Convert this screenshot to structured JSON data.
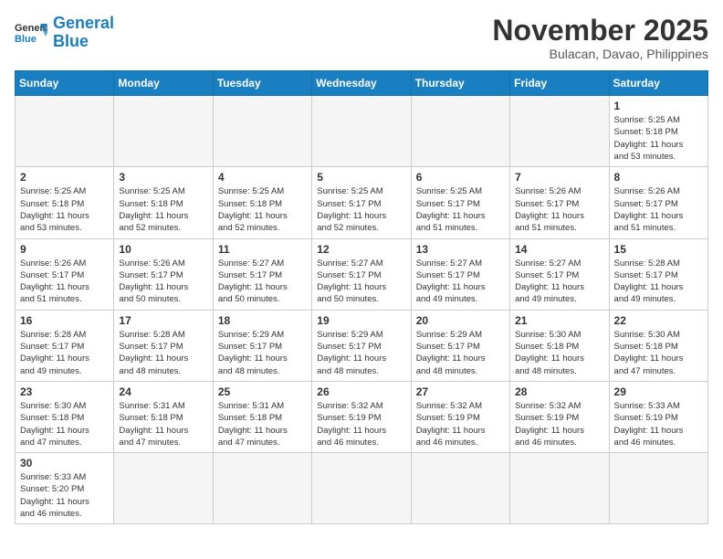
{
  "header": {
    "logo_general": "General",
    "logo_blue": "Blue",
    "month_title": "November 2025",
    "subtitle": "Bulacan, Davao, Philippines"
  },
  "weekdays": [
    "Sunday",
    "Monday",
    "Tuesday",
    "Wednesday",
    "Thursday",
    "Friday",
    "Saturday"
  ],
  "weeks": [
    [
      {
        "day": "",
        "info": ""
      },
      {
        "day": "",
        "info": ""
      },
      {
        "day": "",
        "info": ""
      },
      {
        "day": "",
        "info": ""
      },
      {
        "day": "",
        "info": ""
      },
      {
        "day": "",
        "info": ""
      },
      {
        "day": "1",
        "info": "Sunrise: 5:25 AM\nSunset: 5:18 PM\nDaylight: 11 hours\nand 53 minutes."
      }
    ],
    [
      {
        "day": "2",
        "info": "Sunrise: 5:25 AM\nSunset: 5:18 PM\nDaylight: 11 hours\nand 53 minutes."
      },
      {
        "day": "3",
        "info": "Sunrise: 5:25 AM\nSunset: 5:18 PM\nDaylight: 11 hours\nand 52 minutes."
      },
      {
        "day": "4",
        "info": "Sunrise: 5:25 AM\nSunset: 5:18 PM\nDaylight: 11 hours\nand 52 minutes."
      },
      {
        "day": "5",
        "info": "Sunrise: 5:25 AM\nSunset: 5:17 PM\nDaylight: 11 hours\nand 52 minutes."
      },
      {
        "day": "6",
        "info": "Sunrise: 5:25 AM\nSunset: 5:17 PM\nDaylight: 11 hours\nand 51 minutes."
      },
      {
        "day": "7",
        "info": "Sunrise: 5:26 AM\nSunset: 5:17 PM\nDaylight: 11 hours\nand 51 minutes."
      },
      {
        "day": "8",
        "info": "Sunrise: 5:26 AM\nSunset: 5:17 PM\nDaylight: 11 hours\nand 51 minutes."
      }
    ],
    [
      {
        "day": "9",
        "info": "Sunrise: 5:26 AM\nSunset: 5:17 PM\nDaylight: 11 hours\nand 51 minutes."
      },
      {
        "day": "10",
        "info": "Sunrise: 5:26 AM\nSunset: 5:17 PM\nDaylight: 11 hours\nand 50 minutes."
      },
      {
        "day": "11",
        "info": "Sunrise: 5:27 AM\nSunset: 5:17 PM\nDaylight: 11 hours\nand 50 minutes."
      },
      {
        "day": "12",
        "info": "Sunrise: 5:27 AM\nSunset: 5:17 PM\nDaylight: 11 hours\nand 50 minutes."
      },
      {
        "day": "13",
        "info": "Sunrise: 5:27 AM\nSunset: 5:17 PM\nDaylight: 11 hours\nand 49 minutes."
      },
      {
        "day": "14",
        "info": "Sunrise: 5:27 AM\nSunset: 5:17 PM\nDaylight: 11 hours\nand 49 minutes."
      },
      {
        "day": "15",
        "info": "Sunrise: 5:28 AM\nSunset: 5:17 PM\nDaylight: 11 hours\nand 49 minutes."
      }
    ],
    [
      {
        "day": "16",
        "info": "Sunrise: 5:28 AM\nSunset: 5:17 PM\nDaylight: 11 hours\nand 49 minutes."
      },
      {
        "day": "17",
        "info": "Sunrise: 5:28 AM\nSunset: 5:17 PM\nDaylight: 11 hours\nand 48 minutes."
      },
      {
        "day": "18",
        "info": "Sunrise: 5:29 AM\nSunset: 5:17 PM\nDaylight: 11 hours\nand 48 minutes."
      },
      {
        "day": "19",
        "info": "Sunrise: 5:29 AM\nSunset: 5:17 PM\nDaylight: 11 hours\nand 48 minutes."
      },
      {
        "day": "20",
        "info": "Sunrise: 5:29 AM\nSunset: 5:17 PM\nDaylight: 11 hours\nand 48 minutes."
      },
      {
        "day": "21",
        "info": "Sunrise: 5:30 AM\nSunset: 5:18 PM\nDaylight: 11 hours\nand 48 minutes."
      },
      {
        "day": "22",
        "info": "Sunrise: 5:30 AM\nSunset: 5:18 PM\nDaylight: 11 hours\nand 47 minutes."
      }
    ],
    [
      {
        "day": "23",
        "info": "Sunrise: 5:30 AM\nSunset: 5:18 PM\nDaylight: 11 hours\nand 47 minutes."
      },
      {
        "day": "24",
        "info": "Sunrise: 5:31 AM\nSunset: 5:18 PM\nDaylight: 11 hours\nand 47 minutes."
      },
      {
        "day": "25",
        "info": "Sunrise: 5:31 AM\nSunset: 5:18 PM\nDaylight: 11 hours\nand 47 minutes."
      },
      {
        "day": "26",
        "info": "Sunrise: 5:32 AM\nSunset: 5:19 PM\nDaylight: 11 hours\nand 46 minutes."
      },
      {
        "day": "27",
        "info": "Sunrise: 5:32 AM\nSunset: 5:19 PM\nDaylight: 11 hours\nand 46 minutes."
      },
      {
        "day": "28",
        "info": "Sunrise: 5:32 AM\nSunset: 5:19 PM\nDaylight: 11 hours\nand 46 minutes."
      },
      {
        "day": "29",
        "info": "Sunrise: 5:33 AM\nSunset: 5:19 PM\nDaylight: 11 hours\nand 46 minutes."
      }
    ],
    [
      {
        "day": "30",
        "info": "Sunrise: 5:33 AM\nSunset: 5:20 PM\nDaylight: 11 hours\nand 46 minutes."
      },
      {
        "day": "",
        "info": ""
      },
      {
        "day": "",
        "info": ""
      },
      {
        "day": "",
        "info": ""
      },
      {
        "day": "",
        "info": ""
      },
      {
        "day": "",
        "info": ""
      },
      {
        "day": "",
        "info": ""
      }
    ]
  ]
}
